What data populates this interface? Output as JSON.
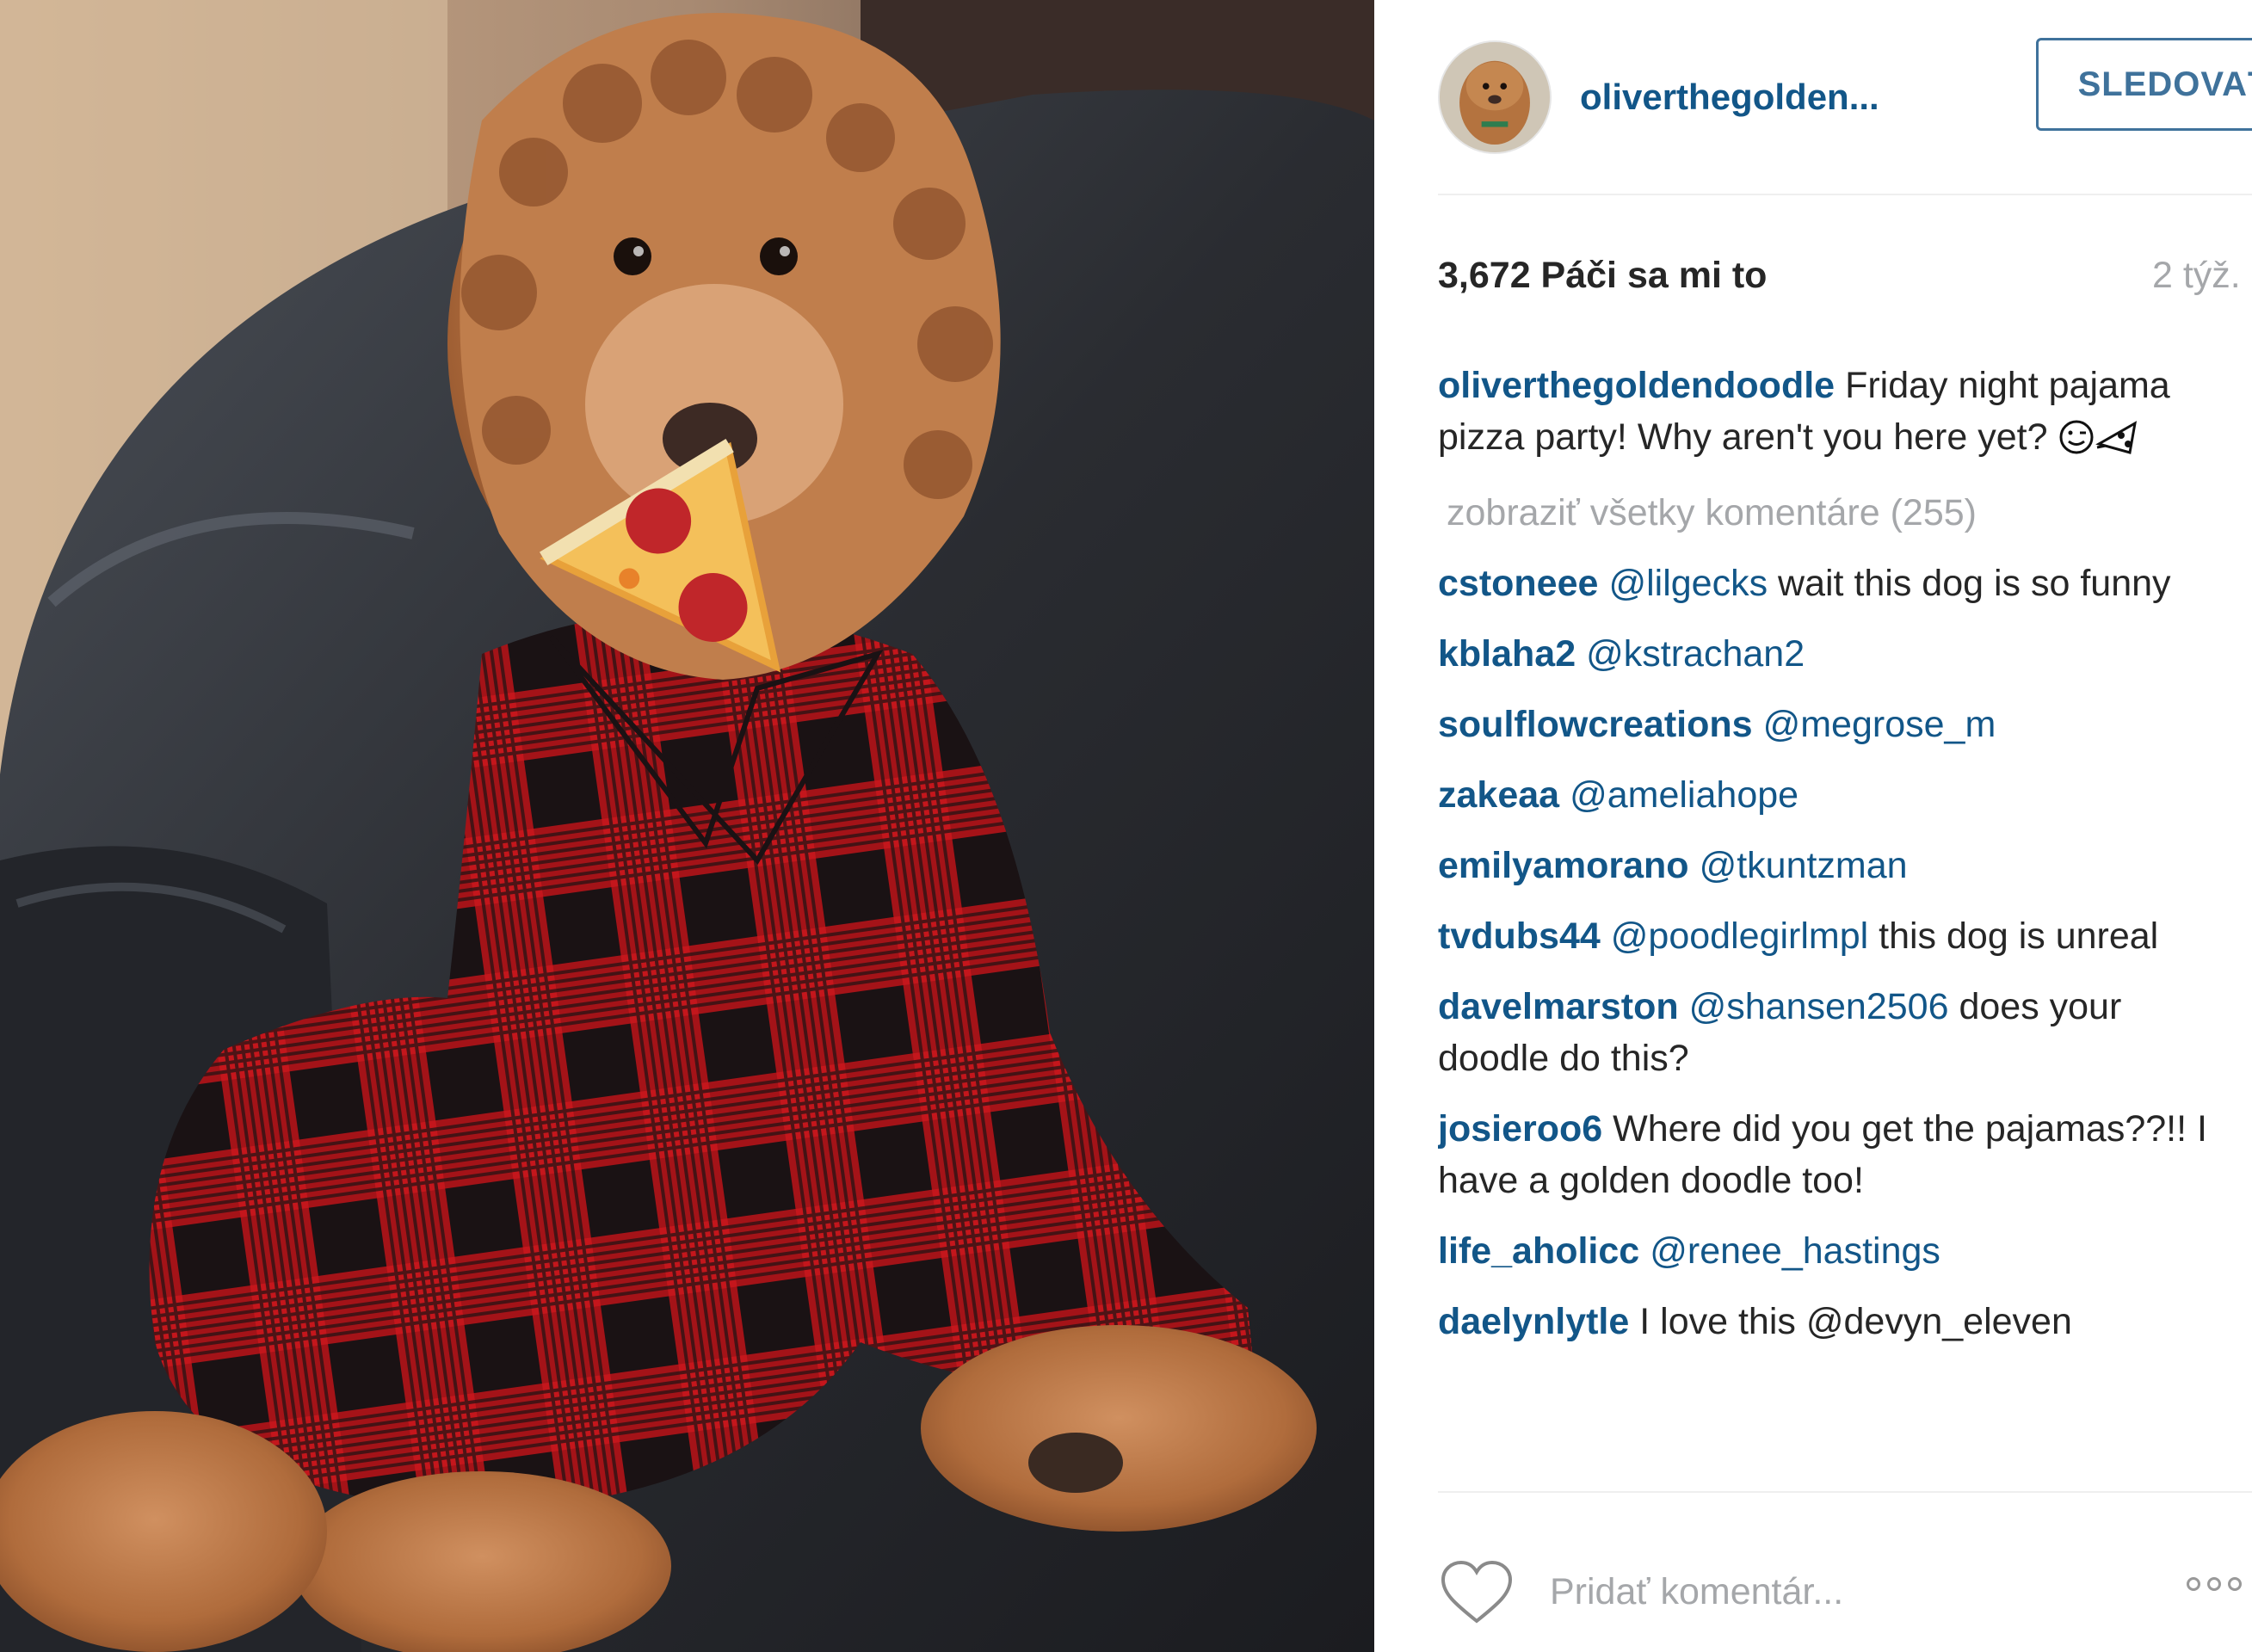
{
  "post": {
    "image_alt": "Golden doodle dog in red and black buffalo-check pajamas holding a slice of pepperoni pizza, sitting in a dark leather armchair"
  },
  "header": {
    "username": "oliverthegolden...",
    "follow_label": "SLEDOVAŤ"
  },
  "meta": {
    "likes": "3,672 Páči sa mi to",
    "time": "2 týž."
  },
  "caption": {
    "user": "oliverthegoldendoodle",
    "text": "Friday night pajama pizza party! Why aren't you here yet?",
    "emojis": [
      "wink-emoji",
      "pizza-emoji"
    ]
  },
  "view_all": "zobraziť všetky komentáre (255)",
  "comments": [
    {
      "user": "cstoneee",
      "mention": "@lilgecks",
      "text": "wait this dog is so funny"
    },
    {
      "user": "kblaha2",
      "mention": "@kstrachan2",
      "text": ""
    },
    {
      "user": "soulflowcreations",
      "mention": "@megrose_m",
      "text": ""
    },
    {
      "user": "zakeaa",
      "mention": "@ameliahope",
      "text": ""
    },
    {
      "user": "emilyamorano",
      "mention": "@tkuntzman",
      "text": ""
    },
    {
      "user": "tvdubs44",
      "mention": "@poodlegirlmpl",
      "text": "this dog is unreal"
    },
    {
      "user": "davelmarston",
      "mention": "@shansen2506",
      "text": "does your doodle do this?"
    },
    {
      "user": "josieroo6",
      "mention": "",
      "text": "Where did you get the pajamas??!! I have a golden doodle too!"
    },
    {
      "user": "life_aholicc",
      "mention": "@renee_hastings",
      "text": ""
    },
    {
      "user": "daelynlytle",
      "mention": "",
      "text": "I love this @devyn_eleven"
    }
  ],
  "footer": {
    "add_comment_placeholder": "Pridať komentár...",
    "like_icon": "heart-icon",
    "more_icon": "more-options-icon"
  },
  "colors": {
    "link": "#125688",
    "follow": "#3f729b",
    "muted": "#a5a7aa",
    "text": "#262626",
    "plaid_red": "#c4161c",
    "plaid_black": "#1a1214"
  }
}
